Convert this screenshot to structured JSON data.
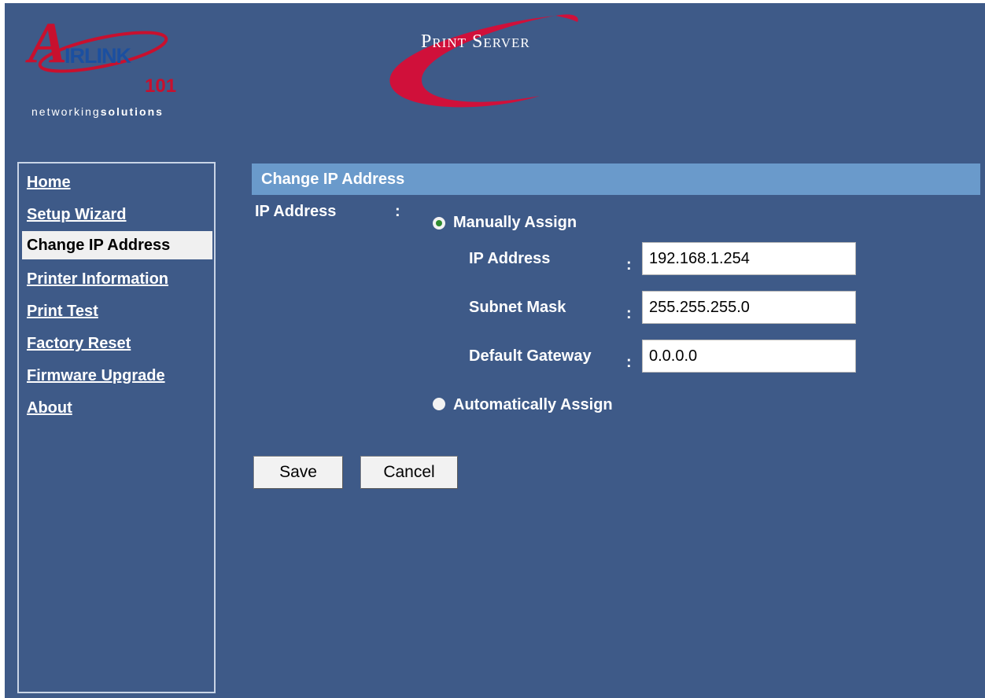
{
  "brand": {
    "logo_text": "IRLINK",
    "logo_number": "101",
    "tagline_light": "networking",
    "tagline_bold": "solutions",
    "product_title": "Print Server",
    "accent_color": "#c8102e"
  },
  "sidebar": {
    "items": [
      {
        "label": "Home",
        "active": false
      },
      {
        "label": "Setup Wizard",
        "active": false
      },
      {
        "label": "Change IP Address",
        "active": true
      },
      {
        "label": "Printer Information",
        "active": false
      },
      {
        "label": "Print Test",
        "active": false
      },
      {
        "label": "Factory Reset",
        "active": false
      },
      {
        "label": "Firmware Upgrade",
        "active": false
      },
      {
        "label": "About",
        "active": false
      }
    ]
  },
  "main": {
    "panel_title": "Change IP Address",
    "ip_label": "IP Address",
    "colon": ":",
    "manual_option": "Manually Assign",
    "auto_option": "Automatically Assign",
    "selected_option": "manual",
    "fields": {
      "ip": {
        "label": "IP Address",
        "value": "192.168.1.254"
      },
      "subnet": {
        "label": "Subnet Mask",
        "value": "255.255.255.0"
      },
      "gateway": {
        "label": "Default Gateway",
        "value": "0.0.0.0"
      }
    },
    "save_label": "Save",
    "cancel_label": "Cancel"
  }
}
